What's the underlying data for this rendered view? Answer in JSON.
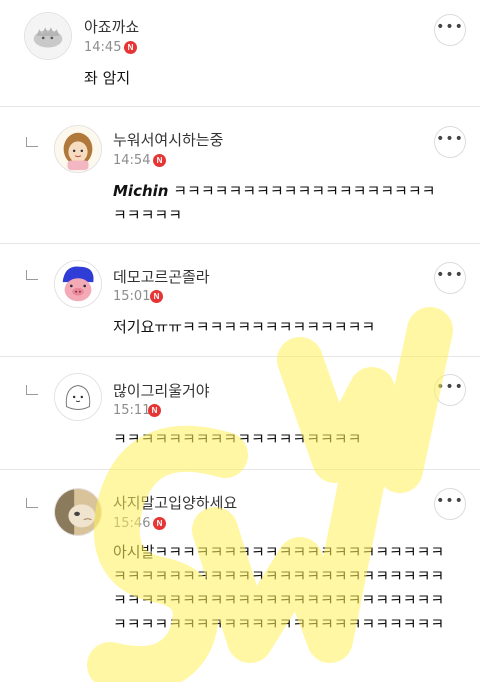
{
  "comments": [
    {
      "nickname": "아죠까쇼",
      "time": "14:45",
      "badge": "N",
      "avatar": "gray-creature-avatar",
      "text": "좌 암지"
    },
    {
      "nickname": "누워서여시하는중",
      "time": "14:54",
      "badge": "N",
      "avatar": "girl-avatar",
      "bold_prefix": "Michin",
      "text": "ㅋㅋㅋㅋㅋㅋㅋㅋㅋㅋㅋㅋㅋㅋㅋㅋㅋㅋㅋㅋㅋㅋㅋㅋ"
    },
    {
      "nickname": "데모고르곤졸라",
      "time": "15:01",
      "badge": "N",
      "avatar": "pig-blue-hair-avatar",
      "text": "저기요ㅠㅠㅋㅋㅋㅋㅋㅋㅋㅋㅋㅋㅋㅋㅋㅋ"
    },
    {
      "nickname": "많이그리울거야",
      "time": "15:11",
      "badge": "N",
      "avatar": "blob-character-avatar",
      "text": "ㅋㅋㅋㅋㅋㅋㅋㅋㅋㅋㅋㅋㅋㅋㅋㅋㅋㅋ"
    },
    {
      "nickname": "사지말고입양하세요",
      "time": "15:46",
      "badge": "N",
      "avatar": "cat-photo-avatar",
      "text": "아시발ㅋㅋㅋㅋㅋㅋㅋㅋㅋㅋㅋㅋㅋㅋㅋㅋㅋㅋㅋㅋㅋㅋㅋㅋㅋㅋㅋㅋㅋㅋㅋㅋㅋㅋㅋㅋㅋㅋㅋㅋㅋㅋㅋㅋㅋㅋㅋㅋㅋㅋㅋㅋㅋㅋㅋㅋㅋㅋㅋㅋㅋㅋㅋㅋㅋㅋㅋㅋㅋㅋㅋㅋㅋㅋㅋㅋㅋㅋㅋㅋㅋㅋㅋㅋㅋㅋㅋㅋㅋㅋㅋㅋㅋ"
    }
  ],
  "more_label": "•••",
  "watermark": {
    "color": "#fff15a"
  }
}
